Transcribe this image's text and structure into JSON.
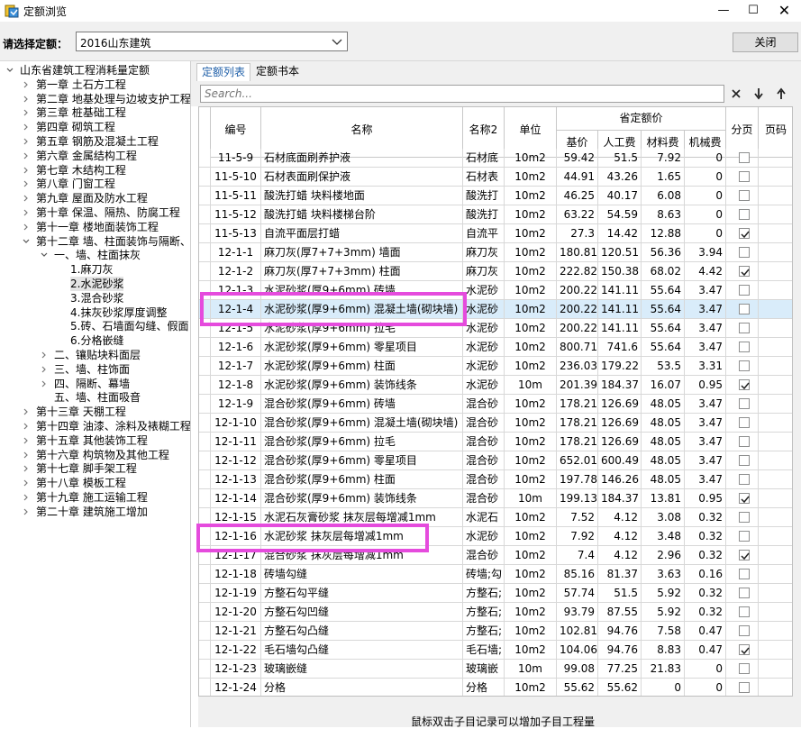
{
  "window": {
    "title": "定额浏览"
  },
  "toolbar": {
    "select_label": "请选择定额：",
    "select_value": "2016山东建筑",
    "close_label": "关闭"
  },
  "tree": {
    "root": "山东省建筑工程消耗量定额",
    "chapters": [
      "第一章 土石方工程",
      "第二章 地基处理与边坡支护工程",
      "第三章 桩基础工程",
      "第四章 砌筑工程",
      "第五章 钢筋及混凝土工程",
      "第六章 金属结构工程",
      "第七章 木结构工程",
      "第八章 门窗工程",
      "第九章 屋面及防水工程",
      "第十章 保温、隔热、防腐工程",
      "第十一章 楼地面装饰工程",
      "第十二章 墙、柱面装饰与隔断、",
      "一、墙、柱面抹灰",
      "1.麻刀灰",
      "2.水泥砂浆",
      "3.混合砂浆",
      "4.抹灰砂浆厚度调整",
      "5.砖、石墙面勾缝、假面",
      "6.分格嵌缝",
      "二、镶贴块料面层",
      "三、墙、柱饰面",
      "四、隔断、幕墙",
      "五、墙、柱面吸音",
      "第十三章 天棚工程",
      "第十四章 油漆、涂料及裱糊工程",
      "第十五章 其他装饰工程",
      "第十六章 构筑物及其他工程",
      "第十七章 脚手架工程",
      "第十八章 模板工程",
      "第十九章 施工运输工程",
      "第二十章 建筑施工增加"
    ]
  },
  "tabs": [
    "定额列表",
    "定额书本"
  ],
  "search": {
    "placeholder": "Search..."
  },
  "table": {
    "headers": {
      "code": "编号",
      "name": "名称",
      "name2": "名称2",
      "unit": "单位",
      "group": "省定额价",
      "base": "基价",
      "labor": "人工费",
      "material": "材料费",
      "machine": "机械费",
      "split": "分页",
      "page": "页码"
    },
    "rows": [
      {
        "code": "11-5-9",
        "name": "石材底面刷养护液",
        "name2": "石材底",
        "unit": "10m2",
        "base": "59.42",
        "labor": "51.5",
        "material": "7.92",
        "machine": "0",
        "checked": false
      },
      {
        "code": "11-5-10",
        "name": "石材表面刷保护液",
        "name2": "石材表",
        "unit": "10m2",
        "base": "44.91",
        "labor": "43.26",
        "material": "1.65",
        "machine": "0",
        "checked": false
      },
      {
        "code": "11-5-11",
        "name": "酸洗打蜡 块料楼地面",
        "name2": "酸洗打",
        "unit": "10m2",
        "base": "46.25",
        "labor": "40.17",
        "material": "6.08",
        "machine": "0",
        "checked": false
      },
      {
        "code": "11-5-12",
        "name": "酸洗打蜡 块料楼梯台阶",
        "name2": "酸洗打",
        "unit": "10m2",
        "base": "63.22",
        "labor": "54.59",
        "material": "8.63",
        "machine": "0",
        "checked": false
      },
      {
        "code": "11-5-13",
        "name": "自流平面层打蜡",
        "name2": "自流平",
        "unit": "10m2",
        "base": "27.3",
        "labor": "14.42",
        "material": "12.88",
        "machine": "0",
        "checked": true
      },
      {
        "code": "12-1-1",
        "name": "麻刀灰(厚7+7+3mm) 墙面",
        "name2": "麻刀灰",
        "unit": "10m2",
        "base": "180.81",
        "labor": "120.51",
        "material": "56.36",
        "machine": "3.94",
        "checked": false
      },
      {
        "code": "12-1-2",
        "name": "麻刀灰(厚7+7+3mm) 柱面",
        "name2": "麻刀灰",
        "unit": "10m2",
        "base": "222.82",
        "labor": "150.38",
        "material": "68.02",
        "machine": "4.42",
        "checked": true
      },
      {
        "code": "12-1-3",
        "name": "水泥砂浆(厚9+6mm) 砖墙",
        "name2": "水泥砂",
        "unit": "10m2",
        "base": "200.22",
        "labor": "141.11",
        "material": "55.64",
        "machine": "3.47",
        "checked": false
      },
      {
        "code": "12-1-4",
        "name": "水泥砂浆(厚9+6mm) 混凝土墙(砌块墙)",
        "name2": "水泥砂",
        "unit": "10m2",
        "base": "200.22",
        "labor": "141.11",
        "material": "55.64",
        "machine": "3.47",
        "checked": false
      },
      {
        "code": "12-1-5",
        "name": "水泥砂浆(厚9+6mm) 拉毛",
        "name2": "水泥砂",
        "unit": "10m2",
        "base": "200.22",
        "labor": "141.11",
        "material": "55.64",
        "machine": "3.47",
        "checked": false
      },
      {
        "code": "12-1-6",
        "name": "水泥砂浆(厚9+6mm) 零星项目",
        "name2": "水泥砂",
        "unit": "10m2",
        "base": "800.71",
        "labor": "741.6",
        "material": "55.64",
        "machine": "3.47",
        "checked": false
      },
      {
        "code": "12-1-7",
        "name": "水泥砂浆(厚9+6mm) 柱面",
        "name2": "水泥砂",
        "unit": "10m2",
        "base": "236.03",
        "labor": "179.22",
        "material": "53.5",
        "machine": "3.31",
        "checked": false
      },
      {
        "code": "12-1-8",
        "name": "水泥砂浆(厚9+6mm) 装饰线条",
        "name2": "水泥砂",
        "unit": "10m",
        "base": "201.39",
        "labor": "184.37",
        "material": "16.07",
        "machine": "0.95",
        "checked": true
      },
      {
        "code": "12-1-9",
        "name": "混合砂浆(厚9+6mm) 砖墙",
        "name2": "混合砂",
        "unit": "10m2",
        "base": "178.21",
        "labor": "126.69",
        "material": "48.05",
        "machine": "3.47",
        "checked": false
      },
      {
        "code": "12-1-10",
        "name": "混合砂浆(厚9+6mm) 混凝土墙(砌块墙)",
        "name2": "混合砂",
        "unit": "10m2",
        "base": "178.21",
        "labor": "126.69",
        "material": "48.05",
        "machine": "3.47",
        "checked": false
      },
      {
        "code": "12-1-11",
        "name": "混合砂浆(厚9+6mm) 拉毛",
        "name2": "混合砂",
        "unit": "10m2",
        "base": "178.21",
        "labor": "126.69",
        "material": "48.05",
        "machine": "3.47",
        "checked": false
      },
      {
        "code": "12-1-12",
        "name": "混合砂浆(厚9+6mm) 零星项目",
        "name2": "混合砂",
        "unit": "10m2",
        "base": "652.01",
        "labor": "600.49",
        "material": "48.05",
        "machine": "3.47",
        "checked": false
      },
      {
        "code": "12-1-13",
        "name": "混合砂浆(厚9+6mm) 柱面",
        "name2": "混合砂",
        "unit": "10m2",
        "base": "197.78",
        "labor": "146.26",
        "material": "48.05",
        "machine": "3.47",
        "checked": false
      },
      {
        "code": "12-1-14",
        "name": "混合砂浆(厚9+6mm) 装饰线条",
        "name2": "混合砂",
        "unit": "10m",
        "base": "199.13",
        "labor": "184.37",
        "material": "13.81",
        "machine": "0.95",
        "checked": true
      },
      {
        "code": "12-1-15",
        "name": "水泥石灰膏砂浆 抹灰层每增减1mm",
        "name2": "水泥石",
        "unit": "10m2",
        "base": "7.52",
        "labor": "4.12",
        "material": "3.08",
        "machine": "0.32",
        "checked": false
      },
      {
        "code": "12-1-16",
        "name": "水泥砂浆 抹灰层每增减1mm",
        "name2": "水泥砂",
        "unit": "10m2",
        "base": "7.92",
        "labor": "4.12",
        "material": "3.48",
        "machine": "0.32",
        "checked": false
      },
      {
        "code": "12-1-17",
        "name": "混合砂浆 抹灰层每增减1mm",
        "name2": "混合砂",
        "unit": "10m2",
        "base": "7.4",
        "labor": "4.12",
        "material": "2.96",
        "machine": "0.32",
        "checked": true
      },
      {
        "code": "12-1-18",
        "name": "砖墙勾缝",
        "name2": "砖墙;勾",
        "unit": "10m2",
        "base": "85.16",
        "labor": "81.37",
        "material": "3.63",
        "machine": "0.16",
        "checked": false
      },
      {
        "code": "12-1-19",
        "name": "方整石勾平缝",
        "name2": "方整石;",
        "unit": "10m2",
        "base": "57.74",
        "labor": "51.5",
        "material": "5.92",
        "machine": "0.32",
        "checked": false
      },
      {
        "code": "12-1-20",
        "name": "方整石勾凹缝",
        "name2": "方整石;",
        "unit": "10m2",
        "base": "93.79",
        "labor": "87.55",
        "material": "5.92",
        "machine": "0.32",
        "checked": false
      },
      {
        "code": "12-1-21",
        "name": "方整石勾凸缝",
        "name2": "方整石;",
        "unit": "10m2",
        "base": "102.81",
        "labor": "94.76",
        "material": "7.58",
        "machine": "0.47",
        "checked": false
      },
      {
        "code": "12-1-22",
        "name": "毛石墙勾凸缝",
        "name2": "毛石墙;",
        "unit": "10m2",
        "base": "104.06",
        "labor": "94.76",
        "material": "8.83",
        "machine": "0.47",
        "checked": true
      },
      {
        "code": "12-1-23",
        "name": "玻璃嵌缝",
        "name2": "玻璃嵌",
        "unit": "10m",
        "base": "99.08",
        "labor": "77.25",
        "material": "21.83",
        "machine": "0",
        "checked": false
      },
      {
        "code": "12-1-24",
        "name": "分格",
        "name2": "分格",
        "unit": "10m2",
        "base": "55.62",
        "labor": "55.62",
        "material": "0",
        "machine": "0",
        "checked": false
      }
    ]
  },
  "footer": {
    "text": "鼠标双击子目记录可以增加子目工程量"
  },
  "colors": {
    "selected_row": "#d9ecfa",
    "highlight": "#e54bdd",
    "tab_text": "#1f5fa8"
  }
}
